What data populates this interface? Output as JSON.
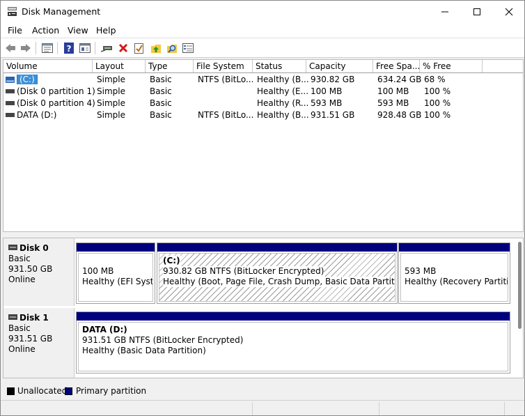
{
  "window": {
    "title": "Disk Management"
  },
  "menu": {
    "file": "File",
    "action": "Action",
    "view": "View",
    "help": "Help"
  },
  "volume_list": {
    "columns": [
      "Volume",
      "Layout",
      "Type",
      "File System",
      "Status",
      "Capacity",
      "Free Spa...",
      "% Free"
    ],
    "rows": [
      {
        "volume": "(C:)",
        "layout": "Simple",
        "type": "Basic",
        "fs": "NTFS (BitLo...",
        "status": "Healthy (B...",
        "capacity": "930.82 GB",
        "free": "634.24 GB",
        "pct": "68 %"
      },
      {
        "volume": "(Disk 0 partition 1)",
        "layout": "Simple",
        "type": "Basic",
        "fs": "",
        "status": "Healthy (E...",
        "capacity": "100 MB",
        "free": "100 MB",
        "pct": "100 %"
      },
      {
        "volume": "(Disk 0 partition 4)",
        "layout": "Simple",
        "type": "Basic",
        "fs": "",
        "status": "Healthy (R...",
        "capacity": "593 MB",
        "free": "593 MB",
        "pct": "100 %"
      },
      {
        "volume": "DATA (D:)",
        "layout": "Simple",
        "type": "Basic",
        "fs": "NTFS (BitLo...",
        "status": "Healthy (B...",
        "capacity": "931.51 GB",
        "free": "928.48 GB",
        "pct": "100 %"
      }
    ]
  },
  "disks": [
    {
      "name": "Disk 0",
      "type": "Basic",
      "size": "931.50 GB",
      "state": "Online",
      "partitions": [
        {
          "title": "",
          "line1": "100 MB",
          "line2": "Healthy (EFI System"
        },
        {
          "title": "(C:)",
          "line1": "930.82 GB NTFS (BitLocker Encrypted)",
          "line2": "Healthy (Boot, Page File, Crash Dump, Basic Data Partition)"
        },
        {
          "title": "",
          "line1": "593 MB",
          "line2": "Healthy (Recovery Partition)"
        }
      ]
    },
    {
      "name": "Disk 1",
      "type": "Basic",
      "size": "931.51 GB",
      "state": "Online",
      "partitions": [
        {
          "title": "DATA  (D:)",
          "line1": "931.51 GB NTFS (BitLocker Encrypted)",
          "line2": "Healthy (Basic Data Partition)"
        }
      ]
    }
  ],
  "legend": {
    "unallocated": "Unallocated",
    "primary": "Primary partition"
  },
  "colors": {
    "primary_partition": "#00007f",
    "unallocated": "#000000",
    "selection": "#3a8fd8"
  },
  "icons": {
    "app": "disk-management-icon",
    "back": "back-arrow-icon",
    "forward": "forward-arrow-icon",
    "properties": "properties-icon",
    "help": "help-icon",
    "console": "show-hide-console-icon",
    "connect": "connect-disk-icon",
    "delete": "delete-icon",
    "check": "check-icon",
    "folder_up": "folder-up-icon",
    "search": "search-folder-icon",
    "list": "list-view-icon"
  }
}
